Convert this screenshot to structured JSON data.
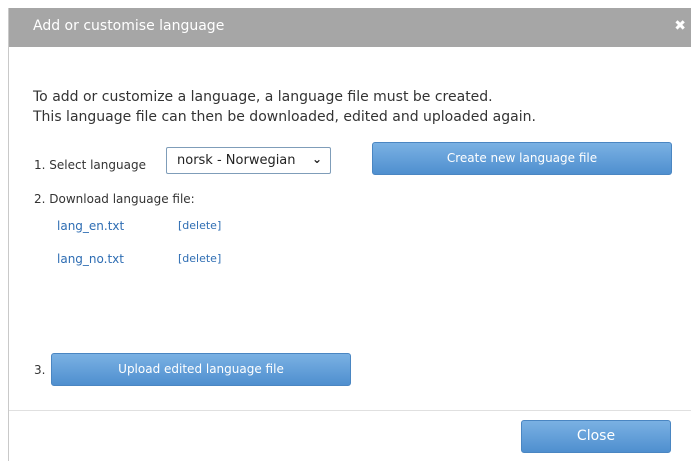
{
  "dialog": {
    "title": "Add or customise language",
    "close_icon": "close-x-icon",
    "intro_line1": "To add or customize a language, a language file must be created.",
    "intro_line2": "This language file can then be downloaded, edited and uploaded again.",
    "step1_label": "1. Select language",
    "selected_language": "norsk - Norwegian",
    "create_button": "Create new language file",
    "step2_label": "2. Download language file:",
    "files": [
      {
        "name": "lang_en.txt",
        "delete_label": "[delete]"
      },
      {
        "name": "lang_no.txt",
        "delete_label": "[delete]"
      }
    ],
    "step3_label": "3.",
    "upload_button": "Upload edited language file",
    "close_button": "Close"
  },
  "colors": {
    "titlebar": "#a6a6a6",
    "button_blue": "#5b9bd9",
    "link": "#2e6db3"
  }
}
